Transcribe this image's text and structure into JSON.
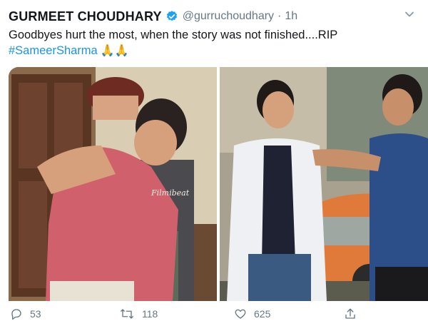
{
  "tweet": {
    "display_name": "GURMEET CHOUDHARY",
    "handle": "@gurruchoudhary",
    "separator": "·",
    "time": "1h",
    "text": "Goodbyes hurt the most, when the story was not finished....RIP",
    "hashtag": "#SameerSharma",
    "emoji": "🙏🙏"
  },
  "media": {
    "watermark": "Filmibeat"
  },
  "actions": {
    "replies": "53",
    "retweets": "118",
    "likes": "625"
  },
  "colors": {
    "hashtag": "#1b95e0",
    "verified": "#1da1f2",
    "muted": "#657786"
  },
  "icons": [
    "verified-badge-icon",
    "chevron-down-icon",
    "reply-icon",
    "retweet-icon",
    "like-icon",
    "share-icon"
  ]
}
